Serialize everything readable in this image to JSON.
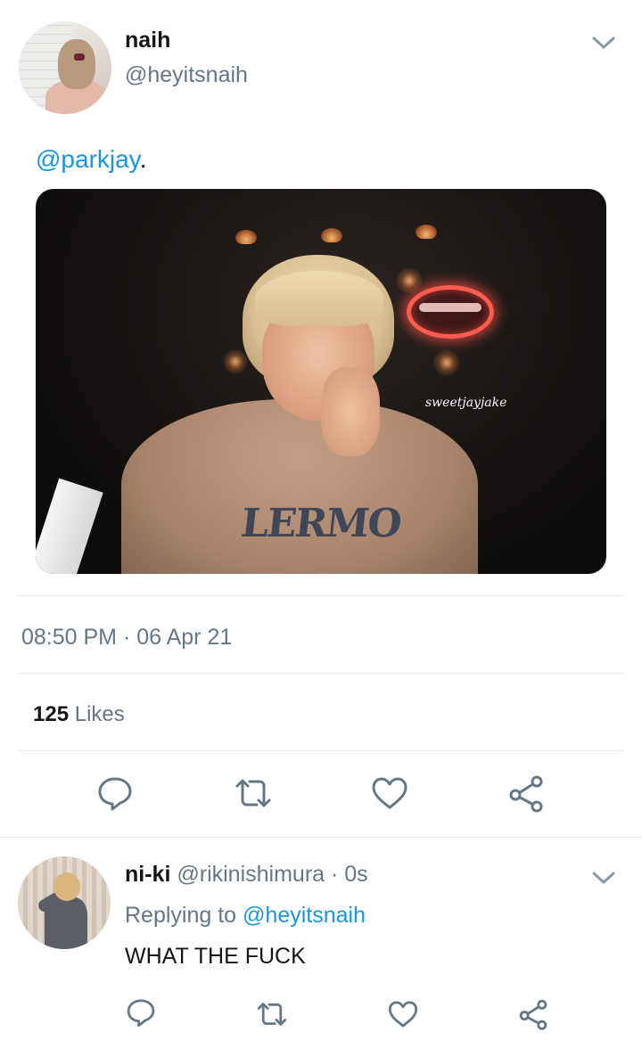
{
  "tweet": {
    "author": {
      "display_name": "naih",
      "handle": "@heyitsnaih"
    },
    "text_mention": "@parkjay",
    "text_suffix": ".",
    "media": {
      "watermark": "sweetjayjake",
      "sweater_text": "LERMO"
    },
    "timestamp": "08:50 PM · 06 Apr 21",
    "likes": {
      "count": "125",
      "label": "Likes"
    },
    "actions": [
      "reply-icon",
      "retweet-icon",
      "like-icon",
      "share-icon"
    ]
  },
  "reply": {
    "author": {
      "display_name": "ni-ki",
      "handle_time": "@rikinishimura · 0s"
    },
    "replying_prefix": "Replying to",
    "replying_handle": "@heyitsnaih",
    "text": "WHAT THE FUCK",
    "actions": [
      "reply-icon",
      "retweet-icon",
      "like-icon",
      "share-icon"
    ]
  },
  "colors": {
    "link": "#1b95e0",
    "secondary_text": "#657786",
    "primary_text": "#14171a",
    "divider": "#e6ecf0"
  }
}
